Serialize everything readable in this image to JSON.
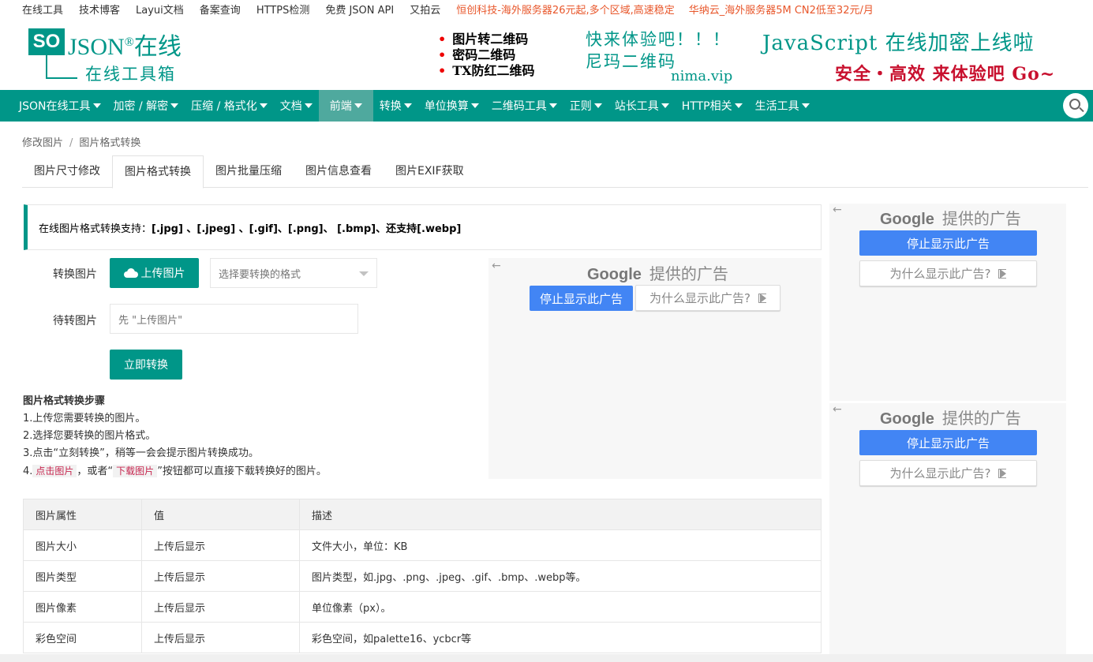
{
  "toplinks": {
    "items": [
      "在线工具",
      "技术博客",
      "Layui文档",
      "备案查询",
      "HTTPS检测",
      "免费 JSON API",
      "又拍云"
    ],
    "ads": [
      "恒创科技-海外服务器26元起,多个区域,高速稳定",
      "华纳云_海外服务器5M CN2低至32元/月"
    ]
  },
  "logo": {
    "so": "SO",
    "json": "JSON",
    "reg": "®",
    "online": "在线",
    "subtitle": "在线工具箱"
  },
  "promo": {
    "lines": [
      "图片转二维码",
      "密码二维码",
      "TX防红二维码"
    ],
    "cta1": "快来体验吧！！！",
    "cta2": "尼玛二维码",
    "url": "nima.vip",
    "banner1": "JavaScript 在线加密上线啦",
    "banner2": "安全・高效 来体验吧 Go~"
  },
  "nav": {
    "items": [
      "JSON在线工具",
      "加密 / 解密",
      "压缩 / 格式化",
      "文档",
      "前端",
      "转换",
      "单位换算",
      "二维码工具",
      "正则",
      "站长工具",
      "HTTP相关",
      "生活工具"
    ],
    "active_index": 4
  },
  "breadcrumb": {
    "parent": "修改图片",
    "current": "图片格式转换",
    "separator": "/"
  },
  "tabs": [
    "图片尺寸修改",
    "图片格式转换",
    "图片批量压缩",
    "图片信息查看",
    "图片EXIF获取"
  ],
  "notice": {
    "prefix": "在线图片格式转换支持：",
    "formats": "[.jpg] 、[.jpeg] 、[.gif]、[.png]、 [.bmp]、还支持[.webp]"
  },
  "form": {
    "convert_label": "转换图片",
    "upload_button": "上传图片",
    "format_placeholder": "选择要转换的格式",
    "pending_label": "待转图片",
    "pending_placeholder": "先 \"上传图片\"",
    "convert_button": "立即转换"
  },
  "steps": {
    "title": "图片格式转换步骤",
    "s1": "1.上传您需要转换的图片。",
    "s2": "2.选择您要转换的图片格式。",
    "s3": "3.点击“立刻转换”，稍等一会会提示图片转换成功。",
    "s4_prefix": "4.",
    "s4_code1": "点击图片",
    "s4_mid": "，或者“",
    "s4_code2": "下载图片",
    "s4_suffix": "”按钮都可以直接下载转换好的图片。"
  },
  "ad": {
    "back": "←",
    "google": "Google",
    "provided": "提供的广告",
    "stop": "停止显示此广告",
    "why": "为什么显示此广告?"
  },
  "table": {
    "headers": [
      "图片属性",
      "值",
      "描述"
    ],
    "rows": [
      [
        "图片大小",
        "上传后显示",
        "文件大小，单位：KB"
      ],
      [
        "图片类型",
        "上传后显示",
        "图片类型，如.jpg、.png、.jpeg、.gif、.bmp、.webp等。"
      ],
      [
        "图片像素",
        "上传后显示",
        "单位像素（px）。"
      ],
      [
        "彩色空间",
        "上传后显示",
        "彩色空间，如palette16、ycbcr等"
      ]
    ]
  },
  "colors": {
    "primary": "#009688",
    "ad_blue": "#4285f4",
    "link_ad": "#e8562a",
    "promo_red": "#c8102e"
  }
}
